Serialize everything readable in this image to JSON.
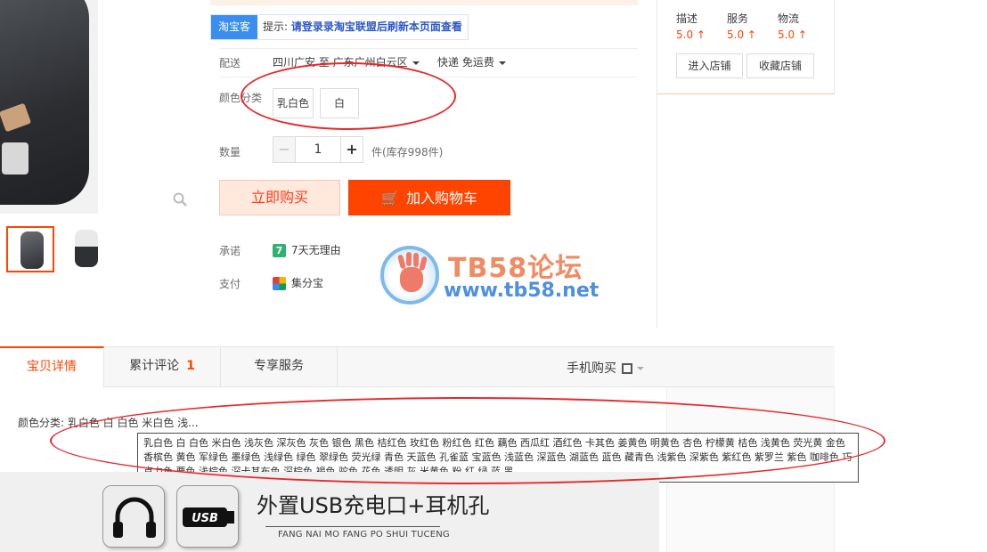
{
  "taoke": {
    "badge": "淘宝客",
    "tip_prefix": "提示: ",
    "tip_text": "请登录录淘宝联盟后刷新本页面查看"
  },
  "shipping": {
    "label": "配送",
    "route": "四川广安 至 广东广州白云区",
    "method": "快递 免运费"
  },
  "color": {
    "label": "颜色分类",
    "options": [
      "乳白色",
      "白"
    ]
  },
  "quantity": {
    "label": "数量",
    "minus": "−",
    "value": "1",
    "plus": "+",
    "stock": "件(库存998件)"
  },
  "actions": {
    "buy_now": "立即购买",
    "add_to_cart": "加入购物车",
    "cart_icon": "cart-icon"
  },
  "promise": {
    "label": "承诺",
    "icon_text": "7",
    "text": "7天无理由"
  },
  "payment": {
    "label": "支付",
    "text": "集分宝"
  },
  "watermark": {
    "title": "TB58论坛",
    "url": "www.tb58.net"
  },
  "shop": {
    "ratings": [
      {
        "label": "描述",
        "value": "5.0 ↑"
      },
      {
        "label": "服务",
        "value": "5.0 ↑"
      },
      {
        "label": "物流",
        "value": "5.0 ↑"
      }
    ],
    "enter_store": "进入店铺",
    "favorite_store": "收藏店铺"
  },
  "tabs": {
    "details": "宝贝详情",
    "reviews": "累计评论",
    "reviews_count": "1",
    "services": "专享服务",
    "mobile_buy": "手机购买"
  },
  "attributes": {
    "color_line": "颜色分类: 乳白色 白 白色 米白色 浅..."
  },
  "tooltip": {
    "text": "乳白色 白 白色 米白色 浅灰色 深灰色 灰色 银色 黑色 桔红色 玫红色 粉红色 红色 藕色 西瓜红 酒红色 卡其色 姜黄色 明黄色 杏色 柠檬黄 桔色 浅黄色 荧光黄 金色 香槟色 黄色 军绿色 墨绿色 浅绿色 绿色 翠绿色 荧光绿 青色 天蓝色 孔雀蓝 宝蓝色 浅蓝色 深蓝色 湖蓝色 蓝色 藏青色 浅紫色 深紫色 紫红色 紫罗兰 紫色 咖啡色 巧克力色 栗色 浅棕色 深卡其布色 深棕色 褐色 驼色 花色 透明 灰 米黄色 粉 红 绿 蓝 黑"
  },
  "banner": {
    "title": "外置USB充电口+耳机孔",
    "subtitle": "FANG NAI MO FANG PO SHUI TUCENG",
    "icons": [
      "headphones-icon",
      "usb-icon"
    ],
    "usb_text": "USB"
  },
  "colors": {
    "accent": "#ff4400",
    "annotation": "#e8282b",
    "taoke_blue": "#3a8ef0"
  }
}
